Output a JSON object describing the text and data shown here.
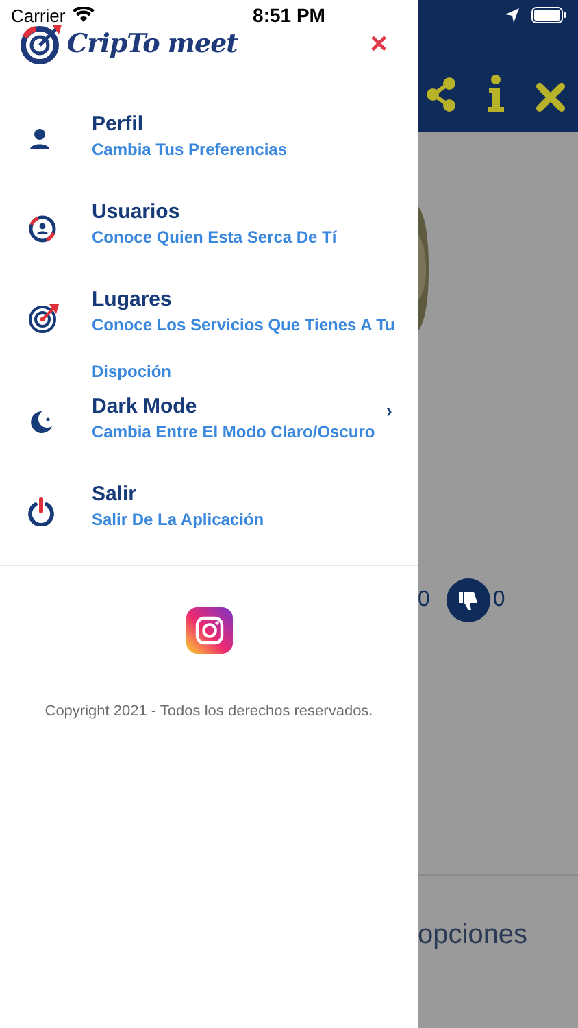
{
  "status_bar": {
    "carrier": "Carrier",
    "time": "8:51 PM"
  },
  "drawer": {
    "logo_text": "CripTo meet",
    "close": "×",
    "items": [
      {
        "kind": "profile",
        "title": "Perfil",
        "subtitle": "Cambia Tus Preferencias"
      },
      {
        "kind": "users",
        "title": "Usuarios",
        "subtitle": "Conoce Quien Esta Serca De Tí"
      },
      {
        "kind": "places",
        "title": "Lugares",
        "subtitle": "Conoce Los Servicios Que Tienes A Tu Dispoción"
      },
      {
        "kind": "moon",
        "title": "Dark Mode",
        "subtitle": "Cambia Entre El Modo Claro/Oscuro",
        "chevron": "›"
      },
      {
        "kind": "power",
        "title": "Salir",
        "subtitle": "Salir De La Aplicación"
      }
    ],
    "copyright": "Copyright 2021 - Todos los derechos reservados."
  },
  "background": {
    "like_count": "0",
    "dislike_count": "0",
    "options_label": "opciones"
  }
}
